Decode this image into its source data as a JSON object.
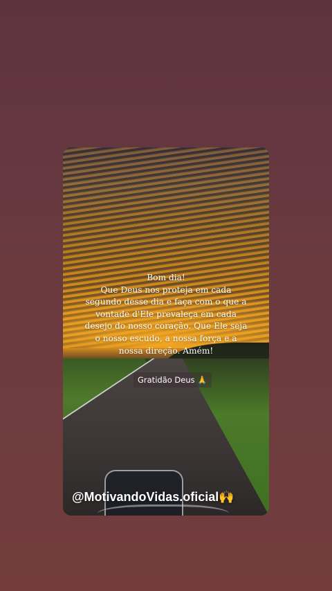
{
  "story": {
    "message_lines": [
      "Bom dia!",
      "Que Deus nos proteja em cada",
      "segundo desse dia e faça com o que a",
      "vontade d'Ele prevaleça em cada",
      "desejo do nosso coração. Que Ele seja",
      "o nosso escudo, a nossa força e a",
      "nossa direção. Amém!"
    ],
    "tag_text": "Gratidão Deus",
    "tag_emoji": "🙏",
    "handle_text": "@MotivandoVidas.oficial",
    "handle_emoji": "🙌"
  },
  "colors": {
    "background": "#6a3a3f",
    "sky_glow": "#e8a428",
    "text": "#ffffff"
  },
  "icons": {
    "tag_icon": "praying-hands-icon",
    "handle_icon": "raised-hands-icon"
  }
}
